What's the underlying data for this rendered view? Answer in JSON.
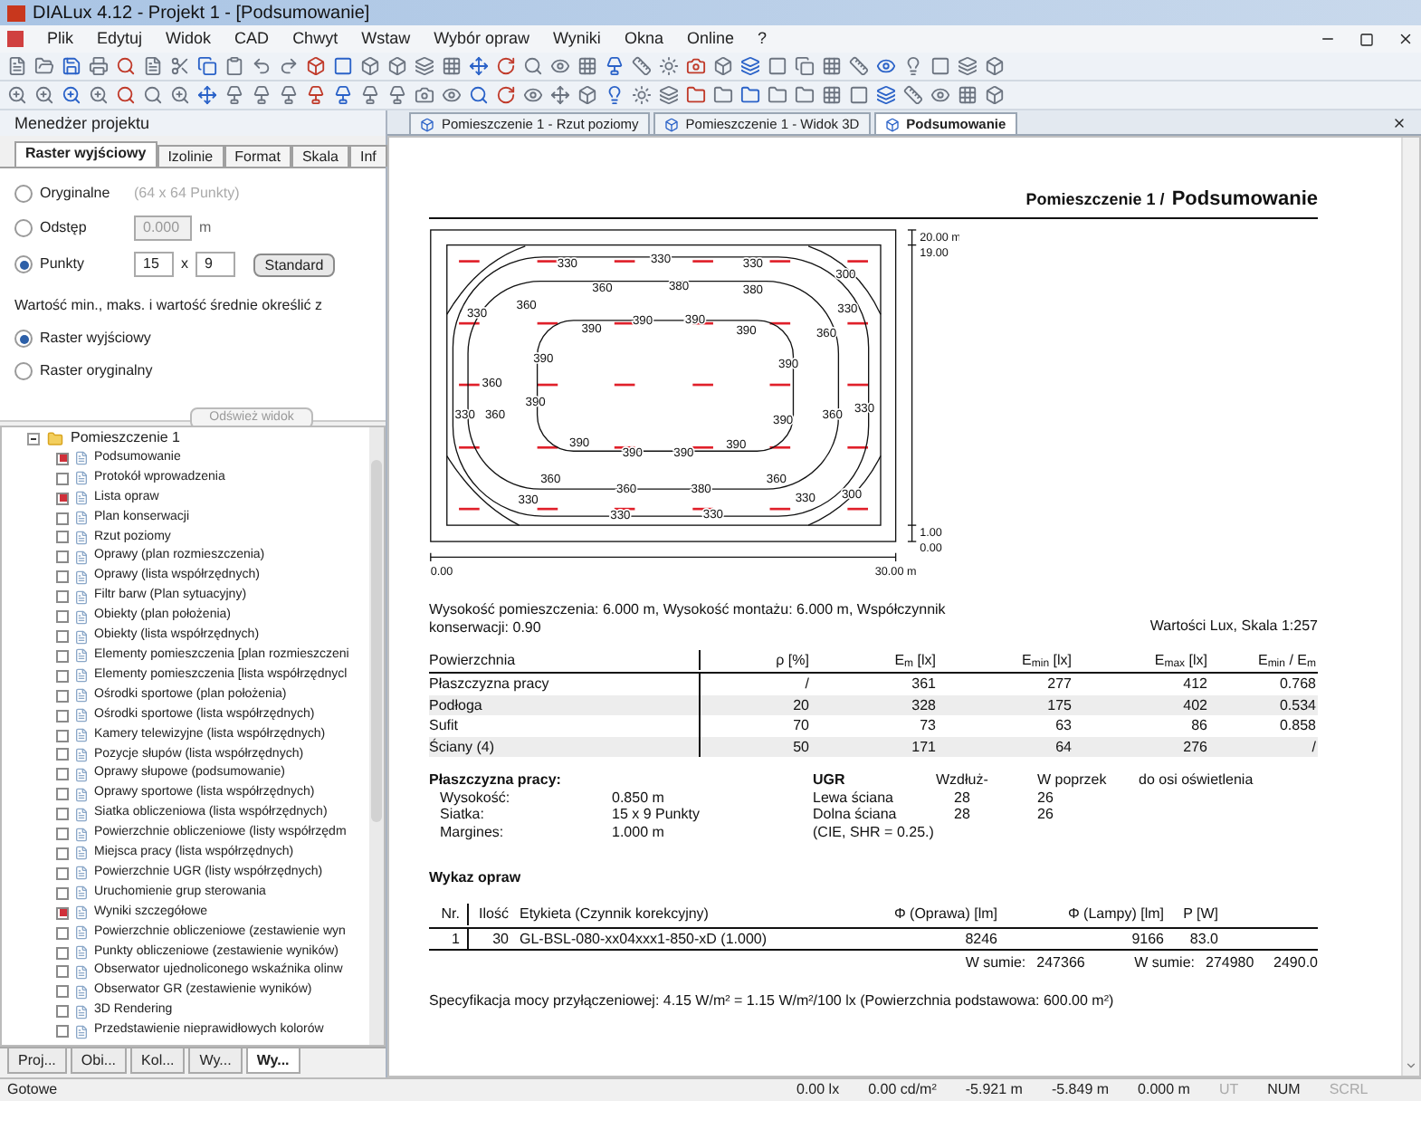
{
  "window": {
    "title": "DIALux 4.12 - Projekt 1 - [Podsumowanie]"
  },
  "menu": [
    "Plik",
    "Edytuj",
    "Widok",
    "CAD",
    "Chwyt",
    "Wstaw",
    "Wybór opraw",
    "Wyniki",
    "Okna",
    "Online",
    "?"
  ],
  "left_panel": {
    "title": "Menedżer projektu",
    "tabs": [
      {
        "label": "Raster wyjściowy",
        "selected": true
      },
      {
        "label": "Izolinie",
        "selected": false
      },
      {
        "label": "Format",
        "selected": false
      },
      {
        "label": "Skala",
        "selected": false
      },
      {
        "label": "Inf",
        "selected": false
      }
    ],
    "grid_options": [
      {
        "label": "Oryginalne",
        "selected": false,
        "note": "(64 x 64 Punkty)"
      },
      {
        "label": "Odstęp",
        "selected": false,
        "field": {
          "value": "0.000",
          "disabled": true
        },
        "unit": "m"
      },
      {
        "label": "Punkty",
        "selected": true,
        "field_x": {
          "value": "15",
          "disabled": false
        },
        "separator": "x",
        "field_y": {
          "value": "9",
          "disabled": false
        },
        "button": "Standard"
      }
    ],
    "minmax_label": "Wartość min., maks. i wartość średnie określić z",
    "minmax_options": [
      {
        "label": "Raster wyjściowy",
        "selected": true
      },
      {
        "label": "Raster oryginalny",
        "selected": false
      }
    ],
    "refresh_button": {
      "label": "Odśwież widok",
      "disabled": true
    },
    "tree": [
      {
        "label": "Pomieszczenie 1",
        "expanded": true,
        "children": [
          {
            "label": "Podsumowanie",
            "checked": true
          },
          {
            "label": "Protokół wprowadzenia",
            "checked": false
          },
          {
            "label": "Lista opraw",
            "checked": true
          },
          {
            "label": "Plan konserwacji",
            "checked": false
          },
          {
            "label": "Rzut poziomy",
            "checked": false
          },
          {
            "label": "Oprawy (plan rozmieszczenia)",
            "checked": false
          },
          {
            "label": "Oprawy (lista współrzędnych)",
            "checked": false
          },
          {
            "label": "Filtr barw (Plan sytuacyjny)",
            "checked": false
          },
          {
            "label": "Obiekty (plan położenia)",
            "checked": false
          },
          {
            "label": "Obiekty (lista współrzędnych)",
            "checked": false
          },
          {
            "label": "Elementy pomieszczenia [plan rozmieszczeni",
            "checked": false
          },
          {
            "label": "Elementy pomieszczenia [lista współrzędnycl",
            "checked": false
          },
          {
            "label": "Ośrodki sportowe (plan położenia)",
            "checked": false
          },
          {
            "label": "Ośrodki sportowe (lista współrzędnych)",
            "checked": false
          },
          {
            "label": "Kamery telewizyjne (lista współrzędnych)",
            "checked": false
          },
          {
            "label": "Pozycje słupów (lista współrzędnych)",
            "checked": false
          },
          {
            "label": "Oprawy słupowe (podsumowanie)",
            "checked": false
          },
          {
            "label": "Oprawy sportowe (lista współrzędnych)",
            "checked": false
          },
          {
            "label": "Siatka obliczeniowa (lista współrzędnych)",
            "checked": false
          },
          {
            "label": "Powierzchnie obliczeniowe (listy współrzędm",
            "checked": false
          },
          {
            "label": "Miejsca pracy (lista współrzędnych)",
            "checked": false
          },
          {
            "label": "Powierzchnie UGR  (listy współrzędnych)",
            "checked": false
          },
          {
            "label": "Uruchomienie grup sterowania",
            "checked": false
          },
          {
            "label": "Wyniki szczegółowe",
            "checked": true
          },
          {
            "label": "Powierzchnie obliczeniowe (zestawienie wyn",
            "checked": false
          },
          {
            "label": "Punkty obliczeniowe (zestawienie wyników)",
            "checked": false
          },
          {
            "label": "Obserwator ujednoliconego wskaźnika olinw",
            "checked": false
          },
          {
            "label": "Obserwator GR (zestawienie wyników)",
            "checked": false
          },
          {
            "label": "3D Rendering",
            "checked": false
          },
          {
            "label": "Przedstawienie nieprawidłowych kolorów",
            "checked": false
          }
        ]
      }
    ],
    "bottom_tabs": [
      {
        "label": "Proj...",
        "selected": false
      },
      {
        "label": "Obi...",
        "selected": false
      },
      {
        "label": "Kol...",
        "selected": false
      },
      {
        "label": "Wy...",
        "selected": false
      },
      {
        "label": "Wy...",
        "selected": true
      }
    ]
  },
  "doc_tabs": [
    {
      "label": "Pomieszczenie 1 - Rzut poziomy",
      "selected": false
    },
    {
      "label": "Pomieszczenie 1 - Widok 3D",
      "selected": false
    },
    {
      "label": "Podsumowanie",
      "selected": true
    }
  ],
  "document": {
    "title_prefix": "Pomieszczenie 1 /",
    "title": "Podsumowanie",
    "plot": {
      "contour_labels": [
        "330",
        "330",
        "330",
        "300",
        "360",
        "380",
        "380",
        "360",
        "330",
        "330",
        "390",
        "390",
        "390",
        "390",
        "360",
        "390",
        "390",
        "360",
        "330",
        "360",
        "390",
        "390",
        "360",
        "330",
        "390",
        "390",
        "390",
        "390",
        "360",
        "360",
        "380",
        "360",
        "330",
        "330",
        "300",
        "330",
        "330"
      ],
      "scale_labels": [
        "20.00 m",
        "19.00",
        "1.00",
        "0.00",
        "0.00",
        "30.00 m"
      ]
    },
    "description": "Wysokość pomieszczenia: 6.000 m, Wysokość montażu: 6.000 m, Współczynnik konserwacji: 0.90",
    "scale_note": "Wartości Lux, Skala 1:257",
    "surfaces": {
      "columns": [
        "Powierzchnia",
        "ρ [%]",
        "E$_{m}$ [lx]",
        "E$_{min}$ [lx]",
        "E$_{max}$ [lx]",
        "E$_{min}$ / E$_{m}$"
      ],
      "rows": [
        [
          "Płaszczyzna pracy",
          "/",
          "361",
          "277",
          "412",
          "0.768"
        ],
        [
          "Podłoga",
          "20",
          "328",
          "175",
          "402",
          "0.534"
        ],
        [
          "Sufit",
          "70",
          "73",
          "63",
          "86",
          "0.858"
        ],
        [
          "Ściany (4)",
          "50",
          "171",
          "64",
          "276",
          "/"
        ]
      ]
    },
    "work_plane": {
      "title": "Płaszczyzna pracy:",
      "rows": [
        [
          "Wysokość:",
          "0.850 m"
        ],
        [
          "Siatka:",
          "15 x 9 Punkty"
        ],
        [
          "Margines:",
          "1.000 m"
        ]
      ]
    },
    "ugr": {
      "title": "UGR",
      "columns": [
        "",
        "Wzdłuż-",
        "W poprzek",
        "do osi oświetlenia"
      ],
      "rows": [
        [
          "Lewa ściana",
          "28",
          "26"
        ],
        [
          "Dolna ściana",
          "28",
          "26"
        ]
      ],
      "note": "(CIE, SHR = 0.25.)"
    },
    "luminaires": {
      "title": "Wykaz opraw",
      "columns": [
        "Nr.",
        "Ilość",
        "Etykieta (Czynnik korekcyjny)",
        "Φ (Oprawa) [lm]",
        "Φ (Lampy) [lm]",
        "P [W]"
      ],
      "rows": [
        [
          "1",
          "30",
          "GL-BSL-080-xx04xxx1-850-xD (1.000)",
          "8246",
          "9166",
          "83.0"
        ]
      ],
      "totals": {
        "label_1": "W sumie:",
        "value_1": "247366",
        "label_2": "W sumie:",
        "value_2": "274980",
        "value_3": "2490.0"
      }
    },
    "power_spec": "Specyfikacja mocy przyłączeniowej: 4.15 W/m² = 1.15 W/m²/100 lx (Powierzchnia podstawowa: 600.00 m²)"
  },
  "status_bar": {
    "message": "Gotowe",
    "items": [
      {
        "text": "0.00 lx",
        "enabled": true
      },
      {
        "text": "0.00 cd/m²",
        "enabled": true
      },
      {
        "text": "-5.921 m",
        "enabled": true
      },
      {
        "text": "-5.849 m",
        "enabled": true
      },
      {
        "text": "0.000 m",
        "enabled": true
      },
      {
        "text": "UT",
        "enabled": false
      },
      {
        "text": "NUM",
        "enabled": true
      },
      {
        "text": "SCRL",
        "enabled": false
      }
    ]
  }
}
